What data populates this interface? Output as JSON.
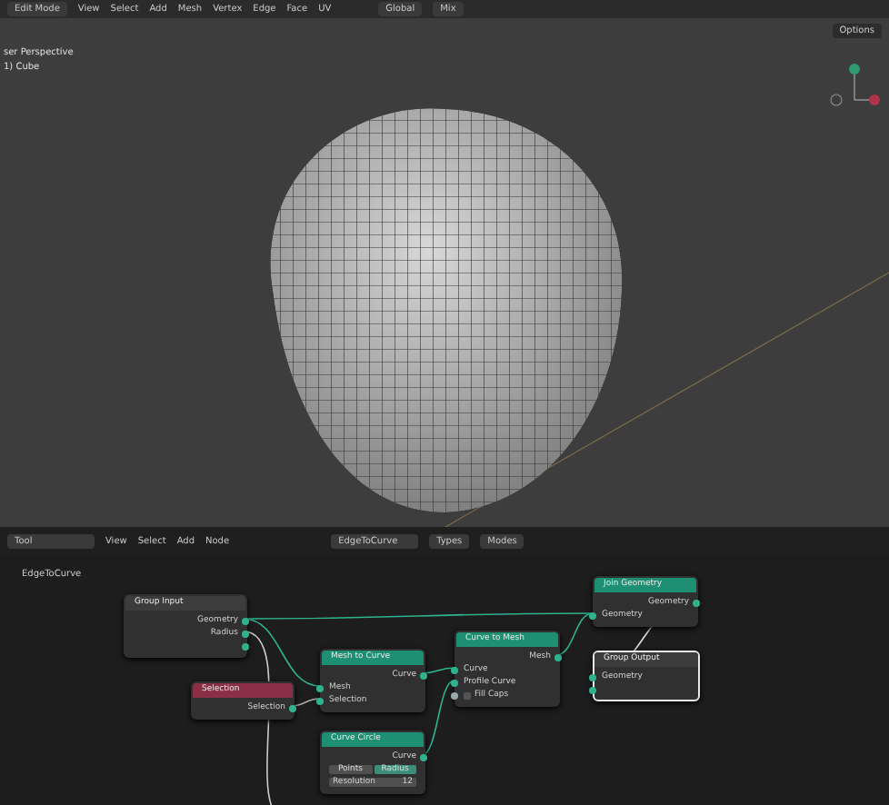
{
  "viewport_header": {
    "mode": "Edit Mode",
    "menus": [
      "View",
      "Select",
      "Add",
      "Mesh",
      "Vertex",
      "Edge",
      "Face",
      "UV"
    ],
    "orientation": "Global",
    "proportional": "Mix"
  },
  "viewport": {
    "options": "Options",
    "view_name": "ser Perspective",
    "object_name": "1) Cube"
  },
  "node_header": {
    "editor": "Tool",
    "menus": [
      "View",
      "Select",
      "Add",
      "Node"
    ],
    "tree_name": "EdgeToCurve",
    "filters": [
      "Types",
      "Modes"
    ]
  },
  "breadcrumb": "EdgeToCurve",
  "nodes": [
    {
      "title": "Group Input",
      "kind": "group",
      "selected": false,
      "rows": [
        {
          "kind": "output",
          "label": "Geometry"
        },
        {
          "kind": "output",
          "label": "Radius"
        },
        {
          "kind": "output"
        }
      ]
    },
    {
      "title": "Join Geometry",
      "kind": "geometry",
      "selected": false,
      "rows": [
        {
          "kind": "output",
          "label": "Geometry"
        },
        {
          "kind": "input",
          "label": "Geometry"
        }
      ]
    },
    {
      "title": "Mesh to Curve",
      "kind": "geometry",
      "selected": false,
      "rows": [
        {
          "kind": "output",
          "label": "Curve"
        },
        {
          "kind": "input",
          "label": "Mesh"
        },
        {
          "kind": "input",
          "label": "Selection"
        }
      ]
    },
    {
      "title": "Selection",
      "kind": "input",
      "selected": false,
      "rows": [
        {
          "kind": "output",
          "label": "Selection"
        }
      ]
    },
    {
      "title": "Curve to Mesh",
      "kind": "geometry",
      "selected": false,
      "rows": [
        {
          "kind": "output",
          "label": "Mesh"
        },
        {
          "kind": "input",
          "label": "Curve"
        },
        {
          "kind": "input",
          "label": "Profile Curve"
        },
        {
          "kind": "checkbox",
          "label": "Fill Caps",
          "checked": false
        }
      ]
    },
    {
      "title": "Group Output",
      "kind": "group",
      "selected": true,
      "rows": [
        {
          "kind": "input",
          "label": "Geometry"
        },
        {
          "kind": "input"
        }
      ]
    },
    {
      "title": "Curve Circle",
      "kind": "geometry",
      "selected": false,
      "rows": [
        {
          "kind": "output",
          "label": "Curve"
        },
        {
          "kind": "toggle",
          "options": [
            {
              "label": "Points",
              "selected": false
            },
            {
              "label": "Radius",
              "selected": true
            }
          ]
        },
        {
          "kind": "field",
          "label": "Resolution",
          "value": "12"
        }
      ]
    }
  ]
}
